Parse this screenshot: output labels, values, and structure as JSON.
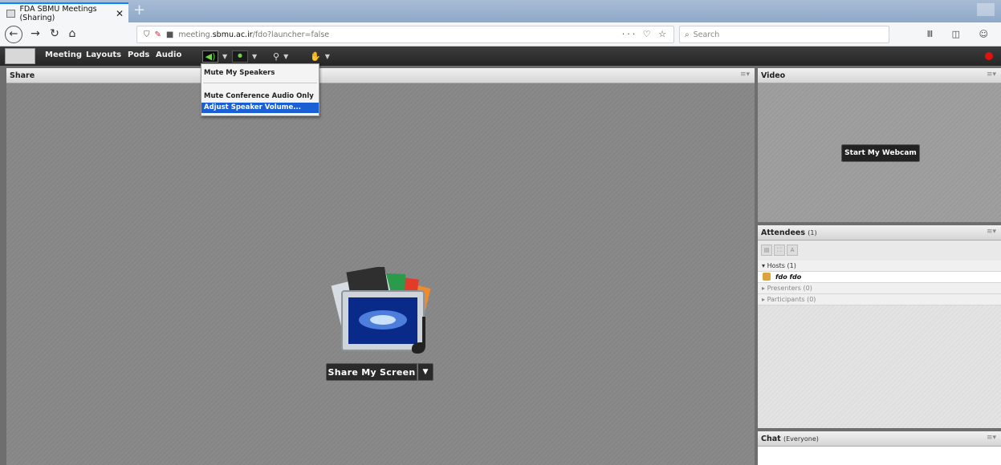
{
  "browser": {
    "tab_title": "FDA SBMU Meetings (Sharing)",
    "tab_close": "✕",
    "new_tab": "+",
    "url_prefix": "meeting.",
    "url_host": "sbmu.ac.ir",
    "url_path": "/fdo?launcher=false",
    "url_actions": "··· ♡ ☆",
    "search_placeholder": "Search"
  },
  "app": {
    "menu": {
      "meeting": "Meeting",
      "layouts": "Layouts",
      "pods": "Pods",
      "audio": "Audio"
    },
    "dropdown": {
      "items": [
        "Mute My Speakers",
        "Mute Conference Audio Only",
        "Adjust Speaker Volume..."
      ],
      "selected_index": 2
    },
    "share_pod": {
      "title": "Share",
      "button_label": "Share My Screen"
    },
    "video_pod": {
      "title": "Video",
      "button_label": "Start My Webcam"
    },
    "attendees_pod": {
      "title": "Attendees",
      "count": "(1)",
      "groups": {
        "hosts": "Hosts (1)",
        "host_user": "fdo fdo",
        "presenters": "Presenters (0)",
        "participants": "Participants (0)"
      }
    },
    "chat_pod": {
      "title": "Chat",
      "scope": "(Everyone)"
    }
  },
  "colors": {
    "selection": "#1a5fd4",
    "record": "#e0120f",
    "audio_active": "#6bd44a"
  }
}
